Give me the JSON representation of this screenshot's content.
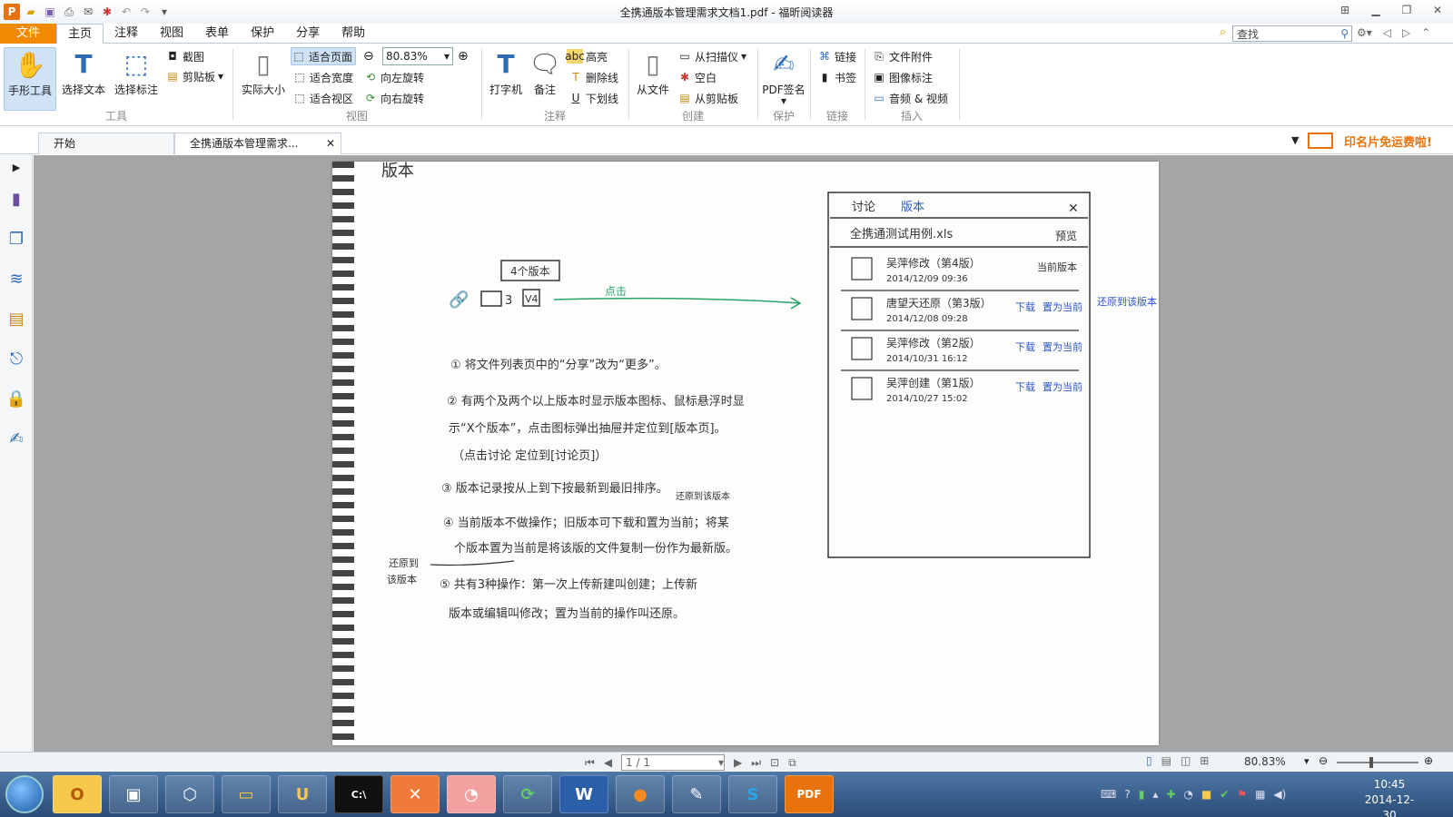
{
  "window": {
    "title": "全携通版本管理需求文档1.pdf - 福昕阅读器"
  },
  "menu": {
    "file": "文件",
    "tabs": [
      "主页",
      "注释",
      "视图",
      "表单",
      "保护",
      "分享",
      "帮助"
    ],
    "search_placeholder": "查找"
  },
  "ribbon": {
    "tools": {
      "label": "工具",
      "hand": "手形工具",
      "select_text": "选择文本",
      "select_annot": "选择标注",
      "screenshot": "截图",
      "clipboard": "剪贴板"
    },
    "view": {
      "label": "视图",
      "actual": "实际大小",
      "fit_page": "适合页面",
      "fit_width": "适合宽度",
      "fit_view": "适合视区",
      "zoom": "80.83%",
      "rotate_left": "向左旋转",
      "rotate_right": "向右旋转"
    },
    "annot": {
      "label": "注释",
      "typewriter": "打字机",
      "note": "备注",
      "highlight": "高亮",
      "strikeout": "删除线",
      "underline": "下划线",
      "abc": "abc",
      "u": "U"
    },
    "create": {
      "label": "创建",
      "from_file": "从文件",
      "from_scanner": "从扫描仪",
      "blank": "空白",
      "from_clipboard": "从剪贴板"
    },
    "protect": {
      "label": "保护",
      "pdf_sign": "PDF签名"
    },
    "links": {
      "label": "链接",
      "link": "链接",
      "bookmark": "书签"
    },
    "insert": {
      "label": "插入",
      "attachment": "文件附件",
      "image": "图像标注",
      "av": "音频 & 视频"
    }
  },
  "doc_tabs": {
    "start": "开始",
    "current": "全携通版本管理需求...",
    "ad": "印名片免运费啦!"
  },
  "page_content": {
    "heading": "版本",
    "bubble": "4个版本",
    "click": "点击",
    "comment_count": "3",
    "version_tag": "V4",
    "notes": [
      "① 将文件列表页中的“分享”改为“更多”。",
      "② 有两个及两个以上版本时显示版本图标、鼠标悬浮时显",
      "示“X个版本”，点击图标弹出抽屉并定位到[版本页]。",
      "（点击讨论 定位到[讨论页]）",
      "③ 版本记录按从上到下按最新到最旧排序。",
      "④ 当前版本不做操作；旧版本可下载和置为当前；将某",
      "个版本置为当前是将该版的文件复制一份作为最新版。",
      "⑤ 共有3种操作：第一次上传新建叫创建；上传新",
      "版本或编辑叫修改；置为当前的操作叫还原。"
    ],
    "side_note": [
      "还原到",
      "该版本"
    ],
    "above_note": "还原到该版本",
    "panel": {
      "tab1": "讨论",
      "tab2": "版本",
      "close": "✕",
      "file": "全携通测试用例.xls",
      "preview": "预览",
      "versions": [
        {
          "title": "吴萍修改（第4版）",
          "time": "2014/12/09 09:36",
          "action": "当前版本",
          "a2": ""
        },
        {
          "title": "唐望天还原（第3版）",
          "time": "2014/12/08 09:28",
          "action": "下载",
          "a2": "置为当前"
        },
        {
          "title": "吴萍修改（第2版）",
          "time": "2014/10/31 16:12",
          "action": "下载",
          "a2": "置为当前"
        },
        {
          "title": "吴萍创建（第1版）",
          "time": "2014/10/27 15:02",
          "action": "下载",
          "a2": "置为当前"
        }
      ],
      "margin_note": "还原到该版本"
    }
  },
  "status": {
    "page": "1 / 1",
    "zoom": "80.83%"
  },
  "taskbar": {
    "time": "10:45",
    "date": "2014-12-30"
  }
}
